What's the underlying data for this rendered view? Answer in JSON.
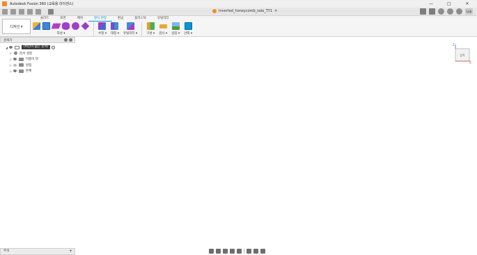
{
  "window": {
    "title": "Autodesk Fusion 360 (교육용 라이센스)",
    "controls": {
      "minimize": "—",
      "maximize": "□",
      "close": "✕"
    }
  },
  "document_tab": {
    "name": "Inverted_honeycomb_sole_TY1"
  },
  "user_badge": "Lab",
  "workspace": {
    "label": "디자인 ▾"
  },
  "ribbon_tabs": [
    {
      "label": "솔리드",
      "active": false
    },
    {
      "label": "표면",
      "active": false
    },
    {
      "label": "메쉬",
      "active": false
    },
    {
      "label": "형식 변형",
      "active": true
    },
    {
      "label": "판금",
      "active": false
    },
    {
      "label": "플라스틱",
      "active": false
    },
    {
      "label": "유틸리티",
      "active": false
    }
  ],
  "tool_groups": [
    {
      "label": "작성 ▾",
      "icons": [
        "box-icon",
        "plane-icon",
        "diamond-icon",
        "cylinder-icon",
        "sphere-icon",
        "torus-icon"
      ]
    },
    {
      "label": "수정 ▾",
      "icons": [
        "edit-form-icon"
      ]
    },
    {
      "label": "대칭 ▾",
      "icons": [
        "symmetry-icon"
      ]
    },
    {
      "label": "유틸리티 ▾",
      "icons": [
        "utility-icon"
      ]
    },
    {
      "label": "구성 ▾",
      "icons": [
        "construct-icon"
      ]
    },
    {
      "label": "검사 ▾",
      "icons": [
        "inspect-icon"
      ]
    },
    {
      "label": "삽입 ▾",
      "icons": [
        "insert-image-icon"
      ]
    },
    {
      "label": "선택 ▾",
      "icons": [
        "select-cursor-icon"
      ]
    }
  ],
  "browser": {
    "title": "검색기",
    "root": "(버전이 없는 문서)",
    "items": [
      {
        "label": "문서 설정",
        "icon": "gear-icon"
      },
      {
        "label": "이름이 뷰",
        "icon": "folder-icon"
      },
      {
        "label": "원점",
        "icon": "folder-icon"
      },
      {
        "label": "본체",
        "icon": "folder-icon"
      }
    ]
  },
  "viewcube": {
    "face": "앞쪽",
    "axis_z": "Z",
    "axis_x": "X"
  },
  "comments_panel": {
    "label": "주석"
  },
  "colors": {
    "mesh_fill": "#8c91e6",
    "mesh_dark": "#2e3270",
    "accent": "#0696d7",
    "ground_shadow": "#b8b8b8",
    "grid_red": "#e06666"
  },
  "nav_tools": [
    "orbit-icon",
    "pan-icon",
    "zoom-icon",
    "fit-icon",
    "display-settings-icon",
    "grid-icon",
    "viewports-icon"
  ]
}
